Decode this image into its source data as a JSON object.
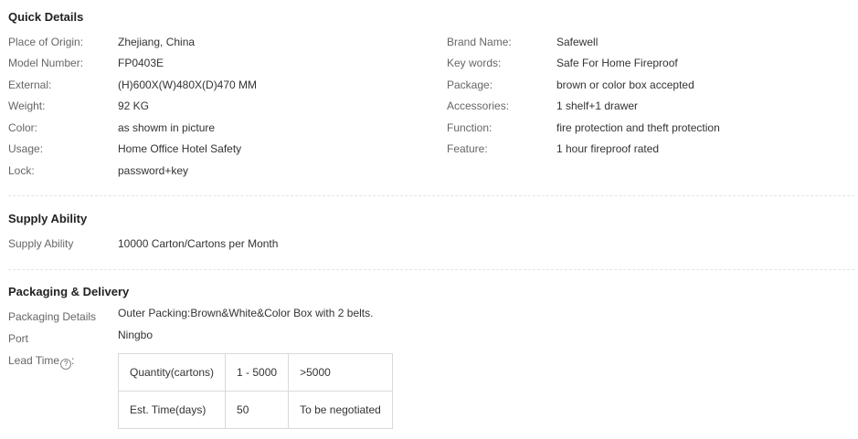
{
  "quick_details": {
    "title": "Quick Details",
    "left": [
      {
        "label": "Place of Origin:",
        "value": "Zhejiang, China"
      },
      {
        "label": "Model Number:",
        "value": "FP0403E"
      },
      {
        "label": "External:",
        "value": "(H)600X(W)480X(D)470 MM"
      },
      {
        "label": "Weight:",
        "value": "92 KG"
      },
      {
        "label": "Color:",
        "value": "as showm in picture"
      },
      {
        "label": "Usage:",
        "value": "Home Office Hotel Safety"
      },
      {
        "label": "Lock:",
        "value": "password+key"
      }
    ],
    "right": [
      {
        "label": "Brand Name:",
        "value": "Safewell"
      },
      {
        "label": "Key words:",
        "value": "Safe For Home Fireproof"
      },
      {
        "label": "Package:",
        "value": "brown or color box accepted"
      },
      {
        "label": "Accessories:",
        "value": "1 shelf+1 drawer"
      },
      {
        "label": "Function:",
        "value": "fire protection and theft protection"
      },
      {
        "label": "Feature:",
        "value": "1 hour fireproof rated"
      }
    ]
  },
  "supply_ability": {
    "title": "Supply Ability",
    "label": "Supply Ability",
    "value": "10000 Carton/Cartons per Month"
  },
  "packaging_delivery": {
    "title": "Packaging & Delivery",
    "packaging_label": "Packaging Details",
    "packaging_value": "Outer Packing:Brown&White&Color Box with 2 belts.",
    "port_label": "Port",
    "port_value": "Ningbo",
    "lead_time_label": "Lead Time",
    "lead_time_suffix": ":",
    "help_glyph": "?",
    "lead_table": {
      "row1": [
        "Quantity(cartons)",
        "1 - 5000",
        ">5000"
      ],
      "row2": [
        "Est. Time(days)",
        "50",
        "To be negotiated"
      ]
    }
  }
}
